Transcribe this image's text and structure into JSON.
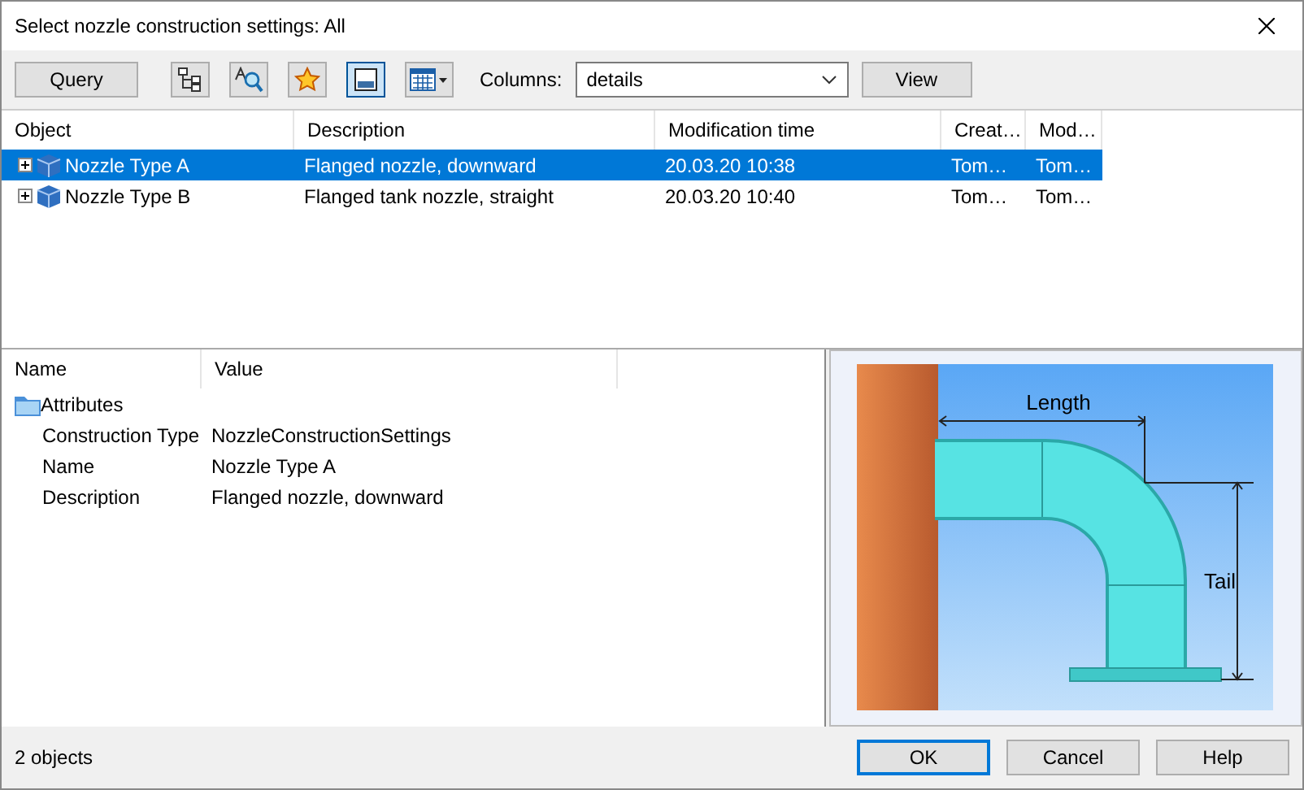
{
  "window": {
    "title": "Select nozzle construction settings: All"
  },
  "toolbar": {
    "query_button": "Query",
    "tools": [
      {
        "kind": "tree",
        "pressed": false
      },
      {
        "kind": "find",
        "pressed": false
      },
      {
        "kind": "star",
        "pressed": false
      },
      {
        "kind": "layout",
        "pressed": true
      },
      {
        "kind": "grid",
        "pressed": false
      }
    ],
    "columns_label": "Columns:",
    "columns_value": "details",
    "view_button": "View"
  },
  "object_list": {
    "columns": [
      "Object",
      "Description",
      "Modification time",
      "Creat…",
      "Mod…"
    ],
    "rows": [
      {
        "cells": [
          "Nozzle Type A",
          "Flanged nozzle, downward",
          "20.03.20  10:38",
          "Tom…",
          "Tom…"
        ],
        "selected": true,
        "expanded": false
      },
      {
        "cells": [
          "Nozzle Type B",
          "Flanged tank nozzle, straight",
          "20.03.20  10:40",
          "Tom…",
          "Tom…"
        ],
        "selected": false,
        "expanded": false
      }
    ]
  },
  "properties": {
    "columns": [
      "Name",
      "Value"
    ],
    "group": "Attributes",
    "rows": [
      {
        "name": "Construction Type",
        "value": "NozzleConstructionSettings"
      },
      {
        "name": "Name",
        "value": "Nozzle Type A"
      },
      {
        "name": "Description",
        "value": "Flanged nozzle, downward"
      }
    ]
  },
  "diagram": {
    "length_label": "Length",
    "tail_label": "Tail"
  },
  "status": "2 objects",
  "buttons": [
    {
      "label": "OK",
      "default": true
    },
    {
      "label": "Cancel",
      "default": false
    },
    {
      "label": "Help",
      "default": false
    }
  ]
}
